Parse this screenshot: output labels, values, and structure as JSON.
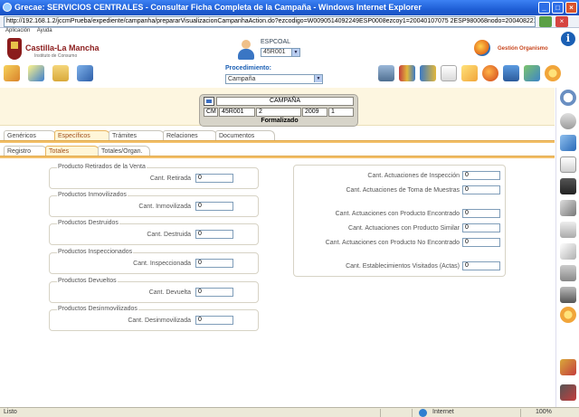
{
  "window": {
    "title": "Grecae: SERVICIOS CENTRALES - Consultar Ficha Completa de la Campaña - Windows Internet Explorer",
    "url": "http://192.168.1.2/jccmPrueba/expediente/campanha/prepararVisualizacionCampanhaAction.do?ezcodigo=W0090514092249ESP0008ezcoy1=20040107075 2ESP980068nodo=200408221027ESP84868"
  },
  "menu": {
    "items": [
      "Aplicación",
      "Ayuda"
    ]
  },
  "brand": {
    "name": "Castilla-La Mancha",
    "subtitle": "Instituto de Consumo"
  },
  "header": {
    "espcoal_label": "ESPCOAL",
    "espcoal_value": "45R001",
    "procedimiento_label": "Procedimiento:",
    "procedimiento_value": "Campaña",
    "gestion_label": "Gestión Organismo",
    "info_icon": "i"
  },
  "campaign": {
    "title": "CAMPAÑA",
    "code_prefix": "CM",
    "espcoal": "45R001",
    "number": "2",
    "year": "2009",
    "sequence": "1",
    "status": "Formalizado"
  },
  "tabs_primary": [
    "Genéricos",
    "Específicos",
    "Trámites",
    "Relaciones",
    "Documentos"
  ],
  "tabs_secondary": [
    "Registro",
    "Totales",
    "Totales/Organ."
  ],
  "left_groups": [
    {
      "legend": "Producto Retirados de la Venta",
      "label": "Cant. Retirada",
      "value": "0"
    },
    {
      "legend": "Productos Inmovilizados",
      "label": "Cant. Inmovilizada",
      "value": "0"
    },
    {
      "legend": "Productos Destruidos",
      "label": "Cant. Destruida",
      "value": "0"
    },
    {
      "legend": "Productos Inspeccionados",
      "label": "Cant. Inspeccionada",
      "value": "0"
    },
    {
      "legend": "Productos Devueltos",
      "label": "Cant. Devuelta",
      "value": "0"
    },
    {
      "legend": "Productos Desinmovilizados",
      "label": "Cant. Desinmovilizada",
      "value": "0"
    }
  ],
  "right_fields": [
    {
      "label": "Cant. Actuaciones de Inspección",
      "value": "0"
    },
    {
      "label": "Cant. Actuaciones de Toma de Muestras",
      "value": "0"
    },
    {
      "label": "Cant. Actuaciones con Producto Encontrado",
      "value": "0"
    },
    {
      "label": "Cant. Actuaciones con Producto Similar",
      "value": "0"
    },
    {
      "label": "Cant. Actuaciones con Producto No Encontrado",
      "value": "0"
    },
    {
      "label": "Cant. Establecimientos Visitados (Actas)",
      "value": "0"
    }
  ],
  "statusbar": {
    "status": "Listo",
    "zone": "Internet",
    "zoom": "100%"
  },
  "colors": {
    "accent_tab": "#f3c06a",
    "title_bar": "#1f5fd6",
    "brand": "#8b1c1c"
  }
}
